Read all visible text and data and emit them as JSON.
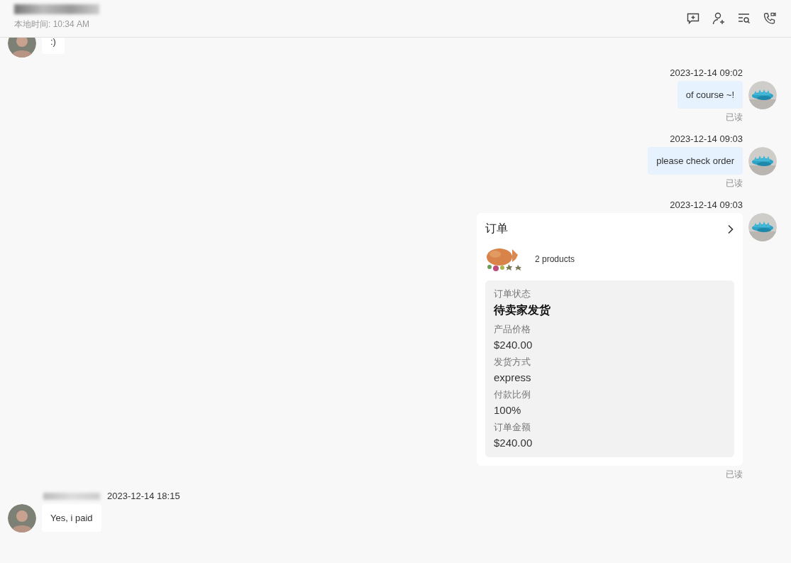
{
  "header": {
    "local_time_label": "本地时间:",
    "local_time": "10:34 AM"
  },
  "messages": [
    {
      "kind": "incoming",
      "text": ":)"
    },
    {
      "kind": "outgoing",
      "time": "2023-12-14 09:02",
      "text": "of course ~!",
      "status": "已读"
    },
    {
      "kind": "outgoing",
      "time": "2023-12-14 09:03",
      "text": "please check order",
      "status": "已读"
    },
    {
      "kind": "order",
      "time": "2023-12-14 09:03",
      "title": "订单",
      "products": "2 products",
      "fields": [
        {
          "label": "订单状态",
          "value": "待卖家发货",
          "emphasis": true
        },
        {
          "label": "产品价格",
          "value": "$240.00",
          "emphasis": false
        },
        {
          "label": "发货方式",
          "value": "express",
          "emphasis": false
        },
        {
          "label": "付款比例",
          "value": "100%",
          "emphasis": false
        },
        {
          "label": "订单金额",
          "value": "$240.00",
          "emphasis": false
        }
      ],
      "status": "已读"
    },
    {
      "kind": "incoming",
      "time": "2023-12-14 18:15",
      "text": "Yes, i paid"
    }
  ]
}
